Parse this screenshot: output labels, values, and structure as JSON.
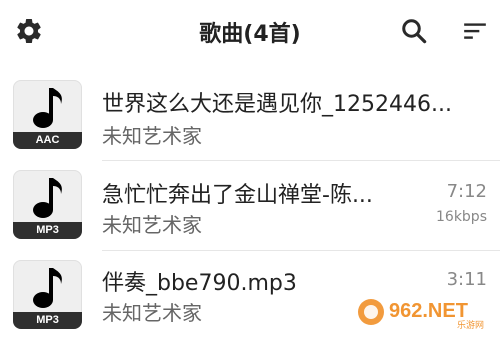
{
  "header": {
    "title": "歌曲(4首)",
    "settings_icon": "gear-icon",
    "search_icon": "search-icon",
    "sort_icon": "sort-icon"
  },
  "songs": [
    {
      "title": "世界这么大还是遇见你_1252446...",
      "artist": "未知艺术家",
      "format": "AAC",
      "duration": "",
      "bitrate": ""
    },
    {
      "title": "急忙忙奔出了金山禅堂-陈...",
      "artist": "未知艺术家",
      "format": "MP3",
      "duration": "7:12",
      "bitrate": "16kbps"
    },
    {
      "title": "伴奏_bbe790.mp3",
      "artist": "未知艺术家",
      "format": "MP3",
      "duration": "3:11",
      "bitrate": ""
    }
  ],
  "watermark": {
    "text": "962.NET",
    "subtext": "乐游网"
  },
  "colors": {
    "accent": "#222222",
    "thumb_bg": "#efefef",
    "label_bg": "#2f2f2f"
  }
}
